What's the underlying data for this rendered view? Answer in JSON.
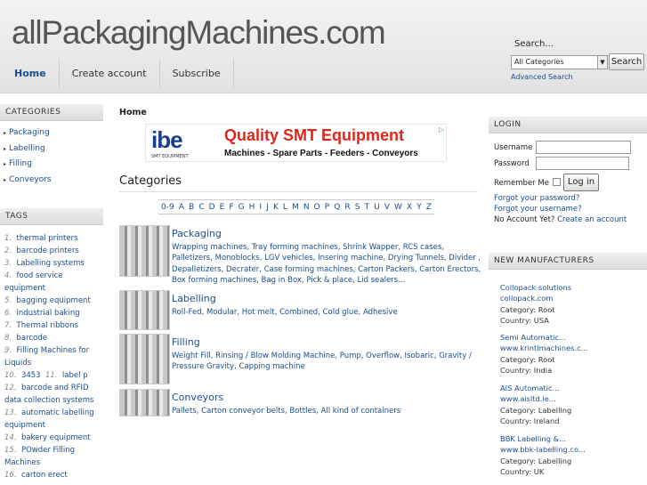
{
  "header": {
    "logo": "allPackagingMachines.com",
    "search_label": "Search...",
    "category_select": "All Categories",
    "search_button": "Search",
    "advanced_search": "Advanced Search"
  },
  "nav": [
    "Home",
    "Create account",
    "Subscribe"
  ],
  "sidebar": {
    "categories_title": "CATEGORIES",
    "categories": [
      "Packaging",
      "Labelling",
      "Filling",
      "Conveyors"
    ],
    "tags_title": "TAGS",
    "tags": [
      {
        "n": "1.",
        "label": "thermal printers"
      },
      {
        "n": "2.",
        "label": "barcode printers"
      },
      {
        "n": "3.",
        "label": "Labelling systems"
      },
      {
        "n": "4.",
        "label": "food service equipment"
      },
      {
        "n": "5.",
        "label": "bagging equipment"
      },
      {
        "n": "6.",
        "label": "industrial baking"
      },
      {
        "n": "7.",
        "label": "Thermal ribbons"
      },
      {
        "n": "8.",
        "label": "barcode"
      },
      {
        "n": "9.",
        "label": "Filling Machines for Liquids"
      },
      {
        "n": "10.",
        "label": "3453"
      },
      {
        "n": "11.",
        "label": "label p"
      },
      {
        "n": "12.",
        "label": "barcode and RFID data collection systems"
      },
      {
        "n": "13.",
        "label": "automatic labelling equipment"
      },
      {
        "n": "14.",
        "label": "bakery equipment"
      },
      {
        "n": "15.",
        "label": "POwder Filling Machines"
      },
      {
        "n": "16.",
        "label": "carton erect"
      }
    ]
  },
  "main": {
    "breadcrumb": "Home",
    "banner": {
      "brand": "ibe",
      "brand_sub": "SMT EQUIPMENT",
      "headline": "Quality SMT Equipment",
      "subline": "Machines - Spare Parts - Feeders - Conveyors"
    },
    "section_title": "Categories",
    "alphabet": [
      "0-9",
      "A",
      "B",
      "C",
      "D",
      "E",
      "F",
      "G",
      "H",
      "I",
      "J",
      "K",
      "L",
      "M",
      "N",
      "O",
      "P",
      "Q",
      "R",
      "S",
      "T",
      "U",
      "V",
      "W",
      "X",
      "Y",
      "Z"
    ],
    "categories": [
      {
        "name": "Packaging",
        "subs": "Wrapping machines, Tray forming machines, Shrink Wapper, RCS cases, Palletizers, Monoblocks, LGV vehicles, Insering machine, Drying Tunnels, Divider , Depalletizers, Decrater, Case forming machines, Carton Packers, Carton Erectors, Box forming machines, Bag in Box, Pick & place, Lid sealers..."
      },
      {
        "name": "Labelling",
        "subs": "Roll-Fed, Modular, Hot melt, Combined, Cold glue, Adhesive"
      },
      {
        "name": "Filling",
        "subs": "Weight Fill, Rinsing / Blow Molding Machine, Pump, Overflow, Isobaric, Gravity / Pressure Gravity, Capping machine"
      },
      {
        "name": "Conveyors",
        "subs": "Pallets, Carton conveyor belts, Bottles, All kind of containers"
      }
    ]
  },
  "login": {
    "title": "LOGIN",
    "username_label": "Username",
    "password_label": "Password",
    "remember_label": "Remember Me",
    "button": "Log in",
    "forgot_password": "Forgot your password?",
    "forgot_username": "Forgot your username?",
    "no_account": "No Account Yet?",
    "create_account": "Create an account"
  },
  "manufacturers": {
    "title": "NEW MANUFACTURERS",
    "items": [
      {
        "name": "Collopack solutions",
        "site": "collopack.com",
        "category": "Category: Root",
        "country": "Country: USA"
      },
      {
        "name": "Semi Automatic...",
        "site": "www.krintlmachines.c...",
        "category": "Category: Root",
        "country": "Country: India"
      },
      {
        "name": "AIS Automatic...",
        "site": "www.aisltd.ie...",
        "category": "Category: Labelling",
        "country": "Country: Ireland"
      },
      {
        "name": "BBK Labelling &...",
        "site": "www.bbk-labelling.co...",
        "category": "Category: Labelling",
        "country": "Country: UK"
      }
    ]
  }
}
